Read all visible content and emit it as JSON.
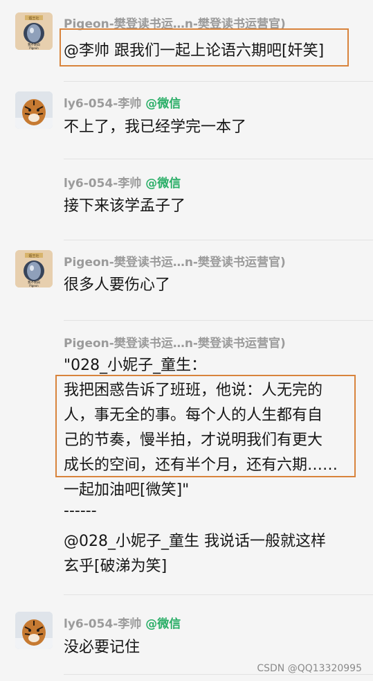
{
  "messages": [
    {
      "sender": "Pigeon-樊登读书运…n-樊登读书运营官)",
      "source": "",
      "lines": [
        "@李帅 跟我们一起上论语六期吧[奸笑]"
      ]
    },
    {
      "sender": "ly6-054-李帅 ",
      "source": "@微信",
      "lines": [
        "不上了，我已经学完一本了"
      ]
    },
    {
      "sender": "ly6-054-李帅 ",
      "source": "@微信",
      "lines": [
        "接下来该学孟子了"
      ]
    },
    {
      "sender": "Pigeon-樊登读书运…n-樊登读书运营官)",
      "source": "",
      "lines": [
        "很多人要伤心了"
      ]
    },
    {
      "sender": "Pigeon-樊登读书运…n-樊登读书运营官)",
      "source": "",
      "lines": [
        "\"028_小妮子_童生：",
        "我把困惑告诉了班班，他说：人无完的",
        "人，事无全的事。每个人的人生都有自",
        "己的节奏，慢半拍，才说明我们有更大",
        "成长的空间，还有半个月，还有六期……",
        "一起加油吧[微笑]\"",
        "------",
        "@028_小妮子_童生 我说话一般就这样",
        "玄乎[破涕为笑]"
      ]
    },
    {
      "sender": "ly6-054-李帅 ",
      "source": "@微信",
      "lines": [
        "没必要记住"
      ]
    }
  ],
  "avatars": {
    "pigeon_banner": "烟王社",
    "pigeon_caption": "我不明白",
    "pigeon_caption2": "Pigeon"
  },
  "watermark": "CSDN @QQ13320995",
  "colors": {
    "background": "#f5f5f5",
    "sender": "#9b9b9b",
    "wechat_green": "#2aae67",
    "highlight": "#d8833b",
    "text": "#161616"
  }
}
